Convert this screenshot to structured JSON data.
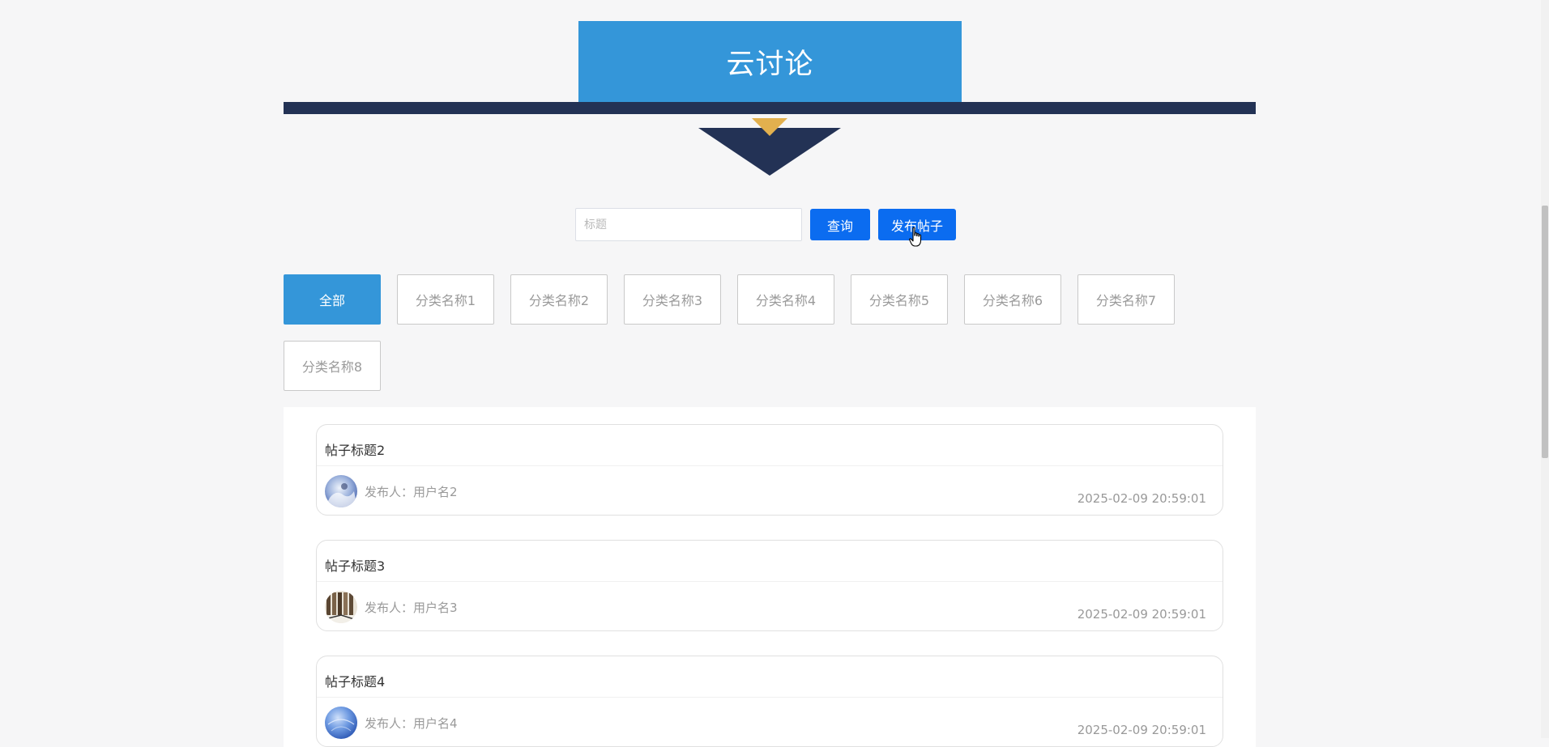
{
  "header": {
    "title": "云讨论"
  },
  "search": {
    "placeholder": "标题",
    "value": "",
    "query_label": "查询",
    "post_label": "发布帖子"
  },
  "categories": [
    {
      "label": "全部",
      "active": true
    },
    {
      "label": "分类名称1",
      "active": false
    },
    {
      "label": "分类名称2",
      "active": false
    },
    {
      "label": "分类名称3",
      "active": false
    },
    {
      "label": "分类名称4",
      "active": false
    },
    {
      "label": "分类名称5",
      "active": false
    },
    {
      "label": "分类名称6",
      "active": false
    },
    {
      "label": "分类名称7",
      "active": false
    },
    {
      "label": "分类名称8",
      "active": false
    }
  ],
  "posts": [
    {
      "title": "帖子标题2",
      "author": "发布人：用户名2",
      "time": "2025-02-09 20:59:01"
    },
    {
      "title": "帖子标题3",
      "author": "发布人：用户名3",
      "time": "2025-02-09 20:59:01"
    },
    {
      "title": "帖子标题4",
      "author": "发布人：用户名4",
      "time": "2025-02-09 20:59:01"
    }
  ],
  "colors": {
    "accent": "#3496d9",
    "button": "#0b6cf0",
    "navy": "#233255",
    "gold": "#e2b04e"
  }
}
